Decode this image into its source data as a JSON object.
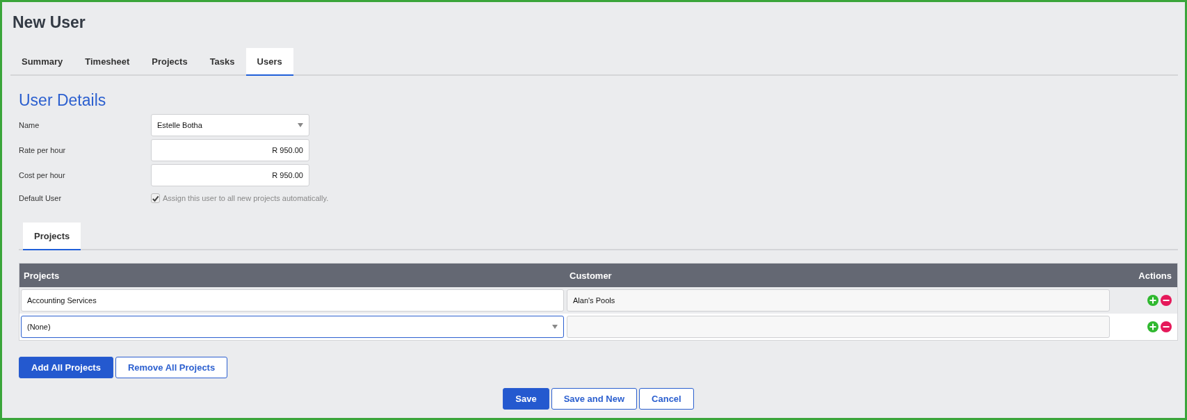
{
  "page_title": "New User",
  "tabs": [
    {
      "label": "Summary",
      "selected": false
    },
    {
      "label": "Timesheet",
      "selected": false
    },
    {
      "label": "Projects",
      "selected": false
    },
    {
      "label": "Tasks",
      "selected": false
    },
    {
      "label": "Users",
      "selected": true
    }
  ],
  "section_title": "User Details",
  "fields": [
    {
      "label": "Name",
      "kind": "select",
      "value": "Estelle Botha"
    },
    {
      "label": "Rate per hour",
      "kind": "text",
      "value": "R 950.00"
    },
    {
      "label": "Cost per hour",
      "kind": "text",
      "value": "R 950.00"
    },
    {
      "label": "Default User",
      "kind": "checkbox",
      "checked": true,
      "disabled": true,
      "text": "Assign this user to all new projects automatically."
    }
  ],
  "sub_tabs": [
    {
      "label": "Projects",
      "selected": true
    }
  ],
  "table": {
    "columns": [
      "Projects",
      "Customer",
      "Actions"
    ],
    "rows": [
      {
        "project": "Accounting Services",
        "kind": "text",
        "focused": false,
        "customer": "Alan's Pools"
      },
      {
        "project": "(None)",
        "kind": "select",
        "focused": true
      }
    ]
  },
  "bulk_buttons": [
    {
      "label": "Add All Projects",
      "primary": true
    },
    {
      "label": "Remove All Projects",
      "primary": false
    }
  ],
  "footer_buttons": [
    {
      "label": "Save",
      "primary": true
    },
    {
      "label": "Save and New",
      "primary": false
    },
    {
      "label": "Cancel",
      "primary": false
    }
  ]
}
